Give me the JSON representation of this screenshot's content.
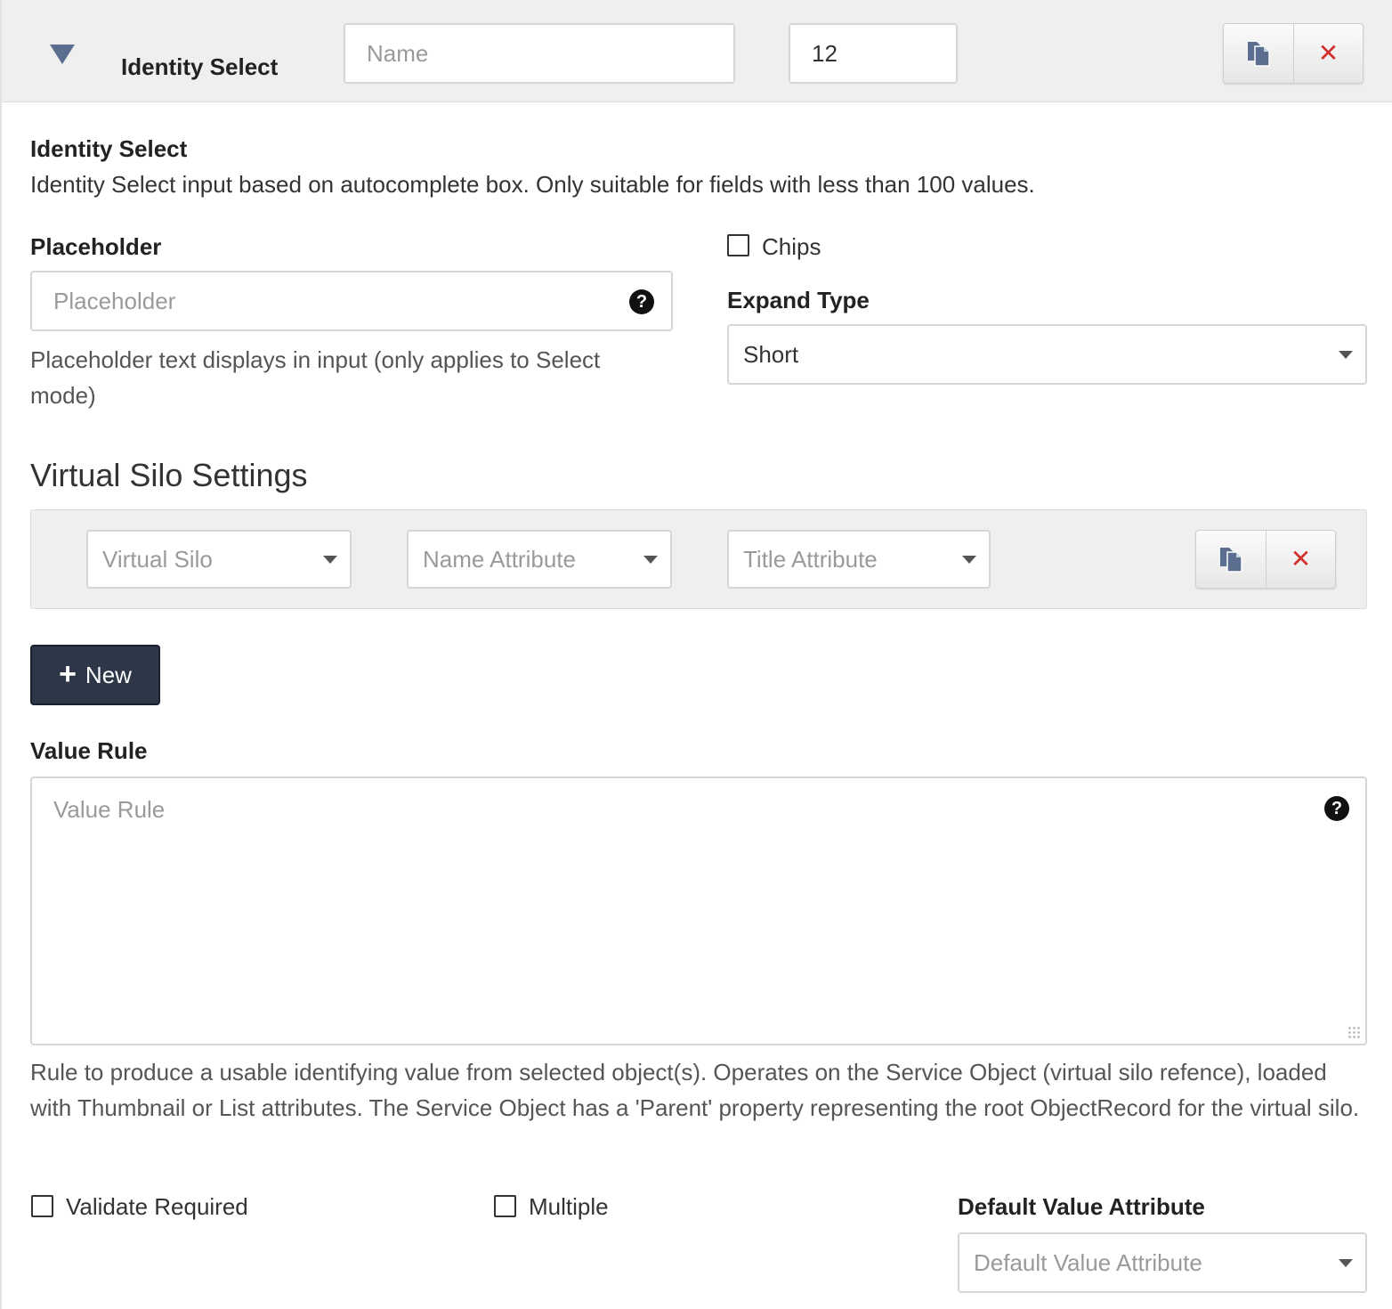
{
  "header": {
    "title": "Identity Select",
    "name_placeholder": "Name",
    "width_value": "12"
  },
  "description": {
    "title": "Identity Select",
    "text": "Identity Select input based on autocomplete box. Only suitable for fields with less than 100 values."
  },
  "placeholder_field": {
    "label": "Placeholder",
    "placeholder": "Placeholder",
    "help": "Placeholder text displays in input (only applies to Select mode)"
  },
  "chips": {
    "label": "Chips",
    "checked": false
  },
  "expand_type": {
    "label": "Expand Type",
    "value": "Short"
  },
  "virtual_silo": {
    "section_title": "Virtual Silo Settings",
    "silo_placeholder": "Virtual Silo",
    "name_attribute_placeholder": "Name Attribute",
    "title_attribute_placeholder": "Title Attribute",
    "new_button": "New"
  },
  "value_rule": {
    "label": "Value Rule",
    "placeholder": "Value Rule",
    "help": "Rule to produce a usable identifying value from selected object(s). Operates on the Service Object (virtual silo refence), loaded with Thumbnail or List attributes. The Service Object has a 'Parent' property representing the root ObjectRecord for the virtual silo."
  },
  "validate_required": {
    "label": "Validate Required",
    "checked": false
  },
  "multiple": {
    "label": "Multiple",
    "checked": false
  },
  "default_value_attribute": {
    "label": "Default Value Attribute",
    "placeholder": "Default Value Attribute"
  },
  "icons": {
    "collapse": "caret-down-icon",
    "copy": "copy-icon",
    "remove": "close-icon",
    "help": "question-circle-icon",
    "add": "plus-icon",
    "dropdown": "chevron-down-icon"
  },
  "colors": {
    "header_bg": "#efefef",
    "caret": "#5b6e8f",
    "remove": "#d0312d",
    "primary_button": "#2d3748"
  }
}
